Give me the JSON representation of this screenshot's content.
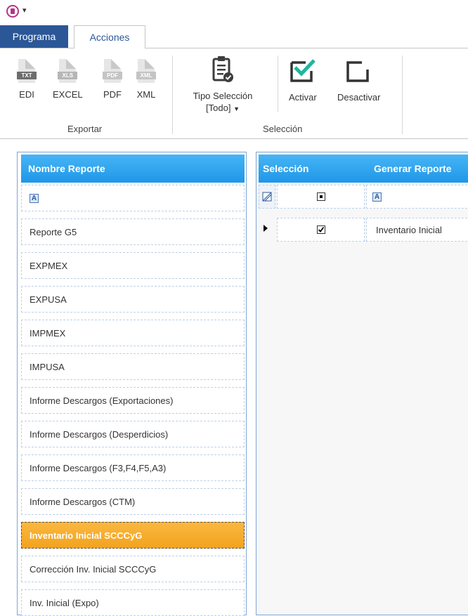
{
  "titlebar": {
    "app_icon": "app-database-icon",
    "quick_access": "▾"
  },
  "tabs": {
    "programa": "Programa",
    "acciones": "Acciones"
  },
  "ribbon": {
    "export_group": {
      "label": "Exportar",
      "buttons": [
        {
          "label": "EDI",
          "icon": "txt-file-icon",
          "tag": "TXT"
        },
        {
          "label": "EXCEL",
          "icon": "xls-file-icon",
          "tag": "XLS"
        },
        {
          "label": "PDF",
          "icon": "pdf-file-icon",
          "tag": "PDF"
        },
        {
          "label": "XML",
          "icon": "xml-file-icon",
          "tag": "XML"
        }
      ]
    },
    "selection_group": {
      "label": "Selección",
      "tipo_line1": "Tipo Selección",
      "tipo_line2": "[Todo]",
      "activar": "Activar",
      "desactivar": "Desactivar"
    }
  },
  "left_panel": {
    "header": "Nombre Reporte",
    "filter_glyph": "A",
    "rows": [
      "Reporte G5",
      "EXPMEX",
      "EXPUSA",
      "IMPMEX",
      "IMPUSA",
      "Informe Descargos (Exportaciones)",
      "Informe Descargos (Desperdicios)",
      "Informe Descargos (F3,F4,F5,A3)",
      "Informe Descargos (CTM)",
      "Inventario Inicial SCCCyG",
      "Corrección Inv. Inicial SCCCyG",
      "Inv. Inicial (Expo)"
    ],
    "selected_index": 9
  },
  "right_panel": {
    "col_seleccion": "Selección",
    "col_generar": "Generar Reporte",
    "filter_glyph": "A",
    "rows": [
      {
        "checked": true,
        "generar": "Inventario Inicial"
      }
    ]
  }
}
